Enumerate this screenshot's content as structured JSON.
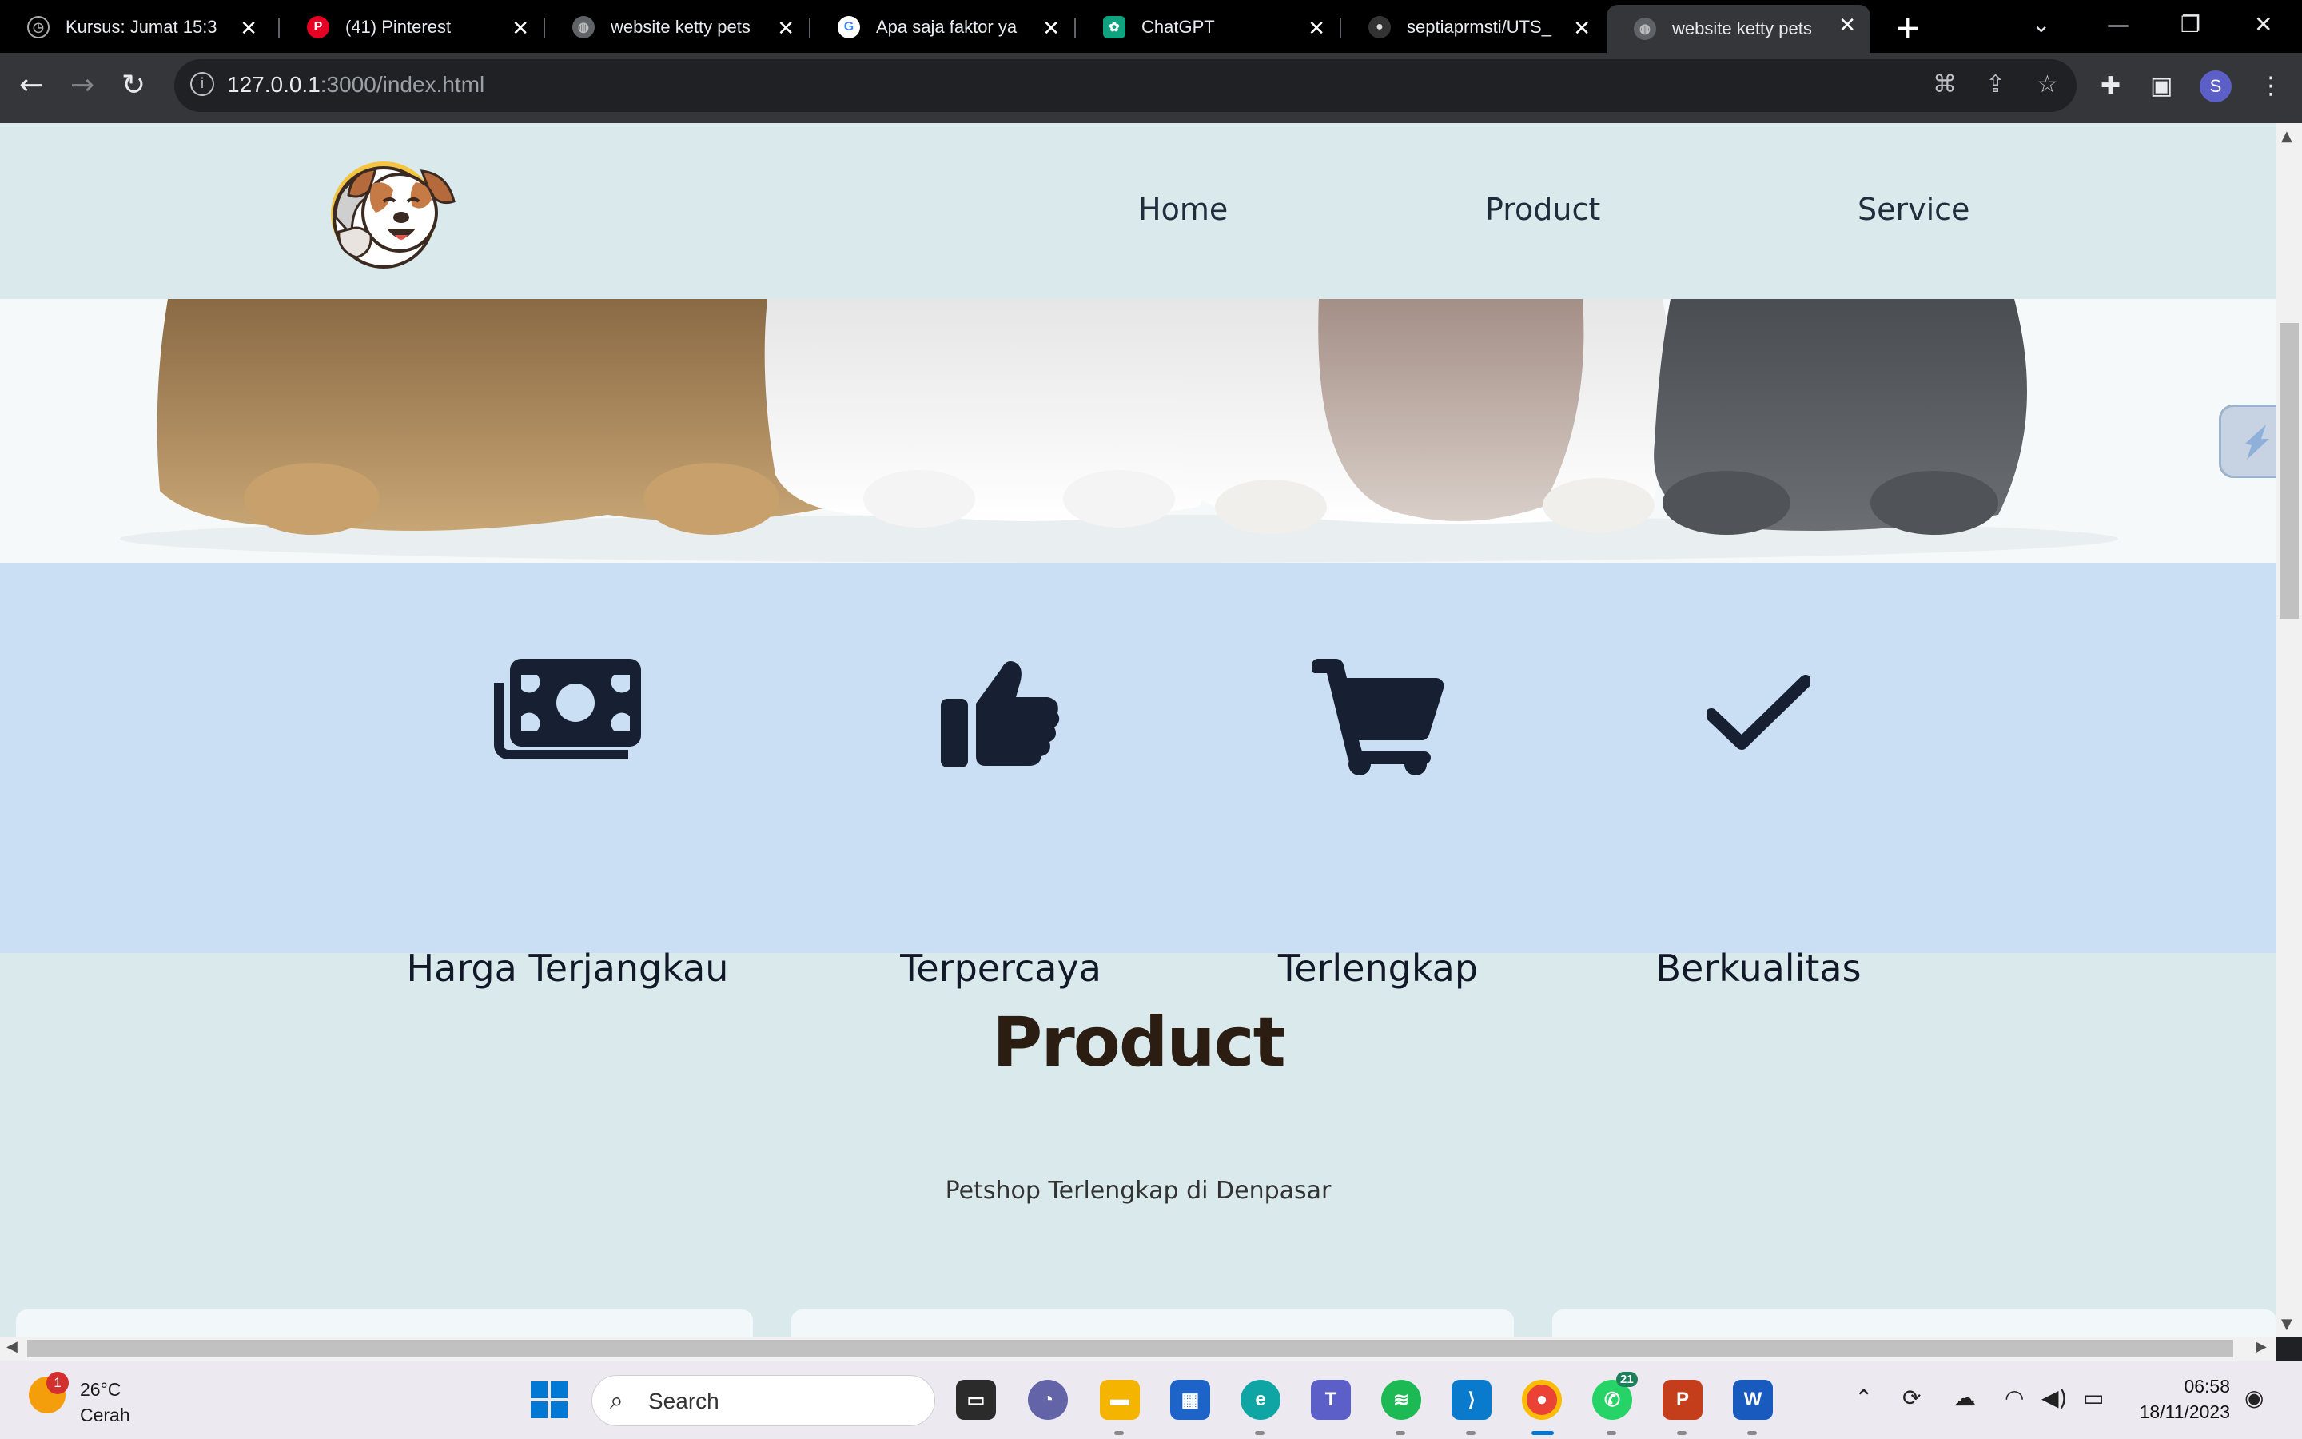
{
  "browser": {
    "tabs": [
      {
        "title": "Kursus: Jumat 15:3",
        "favicon": "moodle-icon"
      },
      {
        "title": "(41) Pinterest",
        "favicon": "pinterest-icon"
      },
      {
        "title": "website ketty pets",
        "favicon": "globe-icon"
      },
      {
        "title": "Apa saja faktor ya",
        "favicon": "google-icon"
      },
      {
        "title": "ChatGPT",
        "favicon": "chatgpt-icon"
      },
      {
        "title": "septiaprmsti/UTS_",
        "favicon": "github-icon"
      },
      {
        "title": "website ketty pets",
        "favicon": "globe-icon"
      }
    ],
    "active_tab": 6,
    "url_host": "127.0.0.1",
    "url_rest": ":3000/index.html",
    "profile_initial": "S"
  },
  "site": {
    "nav": {
      "home": "Home",
      "product": "Product",
      "service": "Service"
    },
    "features": [
      {
        "label": "Harga Terjangkau",
        "icon": "money-icon"
      },
      {
        "label": "Terpercaya",
        "icon": "thumbs-up-icon"
      },
      {
        "label": "Terlengkap",
        "icon": "cart-icon"
      },
      {
        "label": "Berkualitas",
        "icon": "check-icon"
      }
    ],
    "product_title": "Product",
    "product_subtitle": "Petshop Terlengkap di Denpasar"
  },
  "taskbar": {
    "weather_temp": "26°C",
    "weather_desc": "Cerah",
    "weather_badge": "1",
    "search_label": "Search",
    "whatsapp_badge": "21",
    "time": "06:58",
    "date": "18/11/2023"
  },
  "colors": {
    "page_bg": "#daeaec",
    "features_bg": "#cadff4",
    "icon_color": "#172033",
    "title_color": "#2b1d12"
  }
}
